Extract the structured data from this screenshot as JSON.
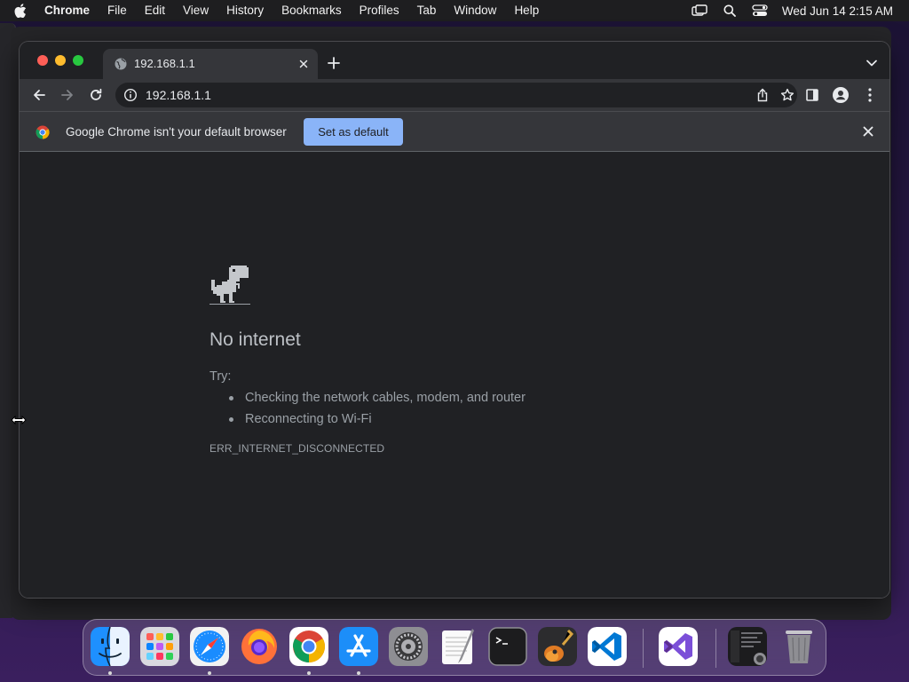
{
  "menubar": {
    "app_name": "Chrome",
    "menus": [
      "File",
      "Edit",
      "View",
      "History",
      "Bookmarks",
      "Profiles",
      "Tab",
      "Window",
      "Help"
    ],
    "clock": "Wed Jun 14  2:15 AM"
  },
  "tab": {
    "title": "192.168.1.1"
  },
  "toolbar": {
    "url": "192.168.1.1"
  },
  "infobar": {
    "message": "Google Chrome isn't your default browser",
    "button_label": "Set as default"
  },
  "error_page": {
    "title": "No internet",
    "try_label": "Try:",
    "suggestions": [
      "Checking the network cables, modem, and router",
      "Reconnecting to Wi-Fi"
    ],
    "error_code": "ERR_INTERNET_DISCONNECTED"
  },
  "colors": {
    "accent_button": "#8ab4f8",
    "page_background": "#202124",
    "toolbar_background": "#35363a"
  },
  "dock": {
    "apps": [
      {
        "name": "finder-icon",
        "running": true
      },
      {
        "name": "launchpad-icon",
        "running": false
      },
      {
        "name": "safari-icon",
        "running": true
      },
      {
        "name": "firefox-icon",
        "running": false
      },
      {
        "name": "chrome-icon",
        "running": true
      },
      {
        "name": "app-store-icon",
        "running": true
      },
      {
        "name": "system-settings-icon",
        "running": false
      },
      {
        "name": "textedit-icon",
        "running": false
      },
      {
        "name": "terminal-icon",
        "running": false
      },
      {
        "name": "garageband-icon",
        "running": false
      },
      {
        "name": "vscode-icon",
        "running": false
      },
      {
        "name": "visual-studio-icon",
        "running": false
      },
      {
        "name": "recent-window-icon",
        "running": false
      },
      {
        "name": "trash-icon",
        "running": false
      }
    ]
  }
}
